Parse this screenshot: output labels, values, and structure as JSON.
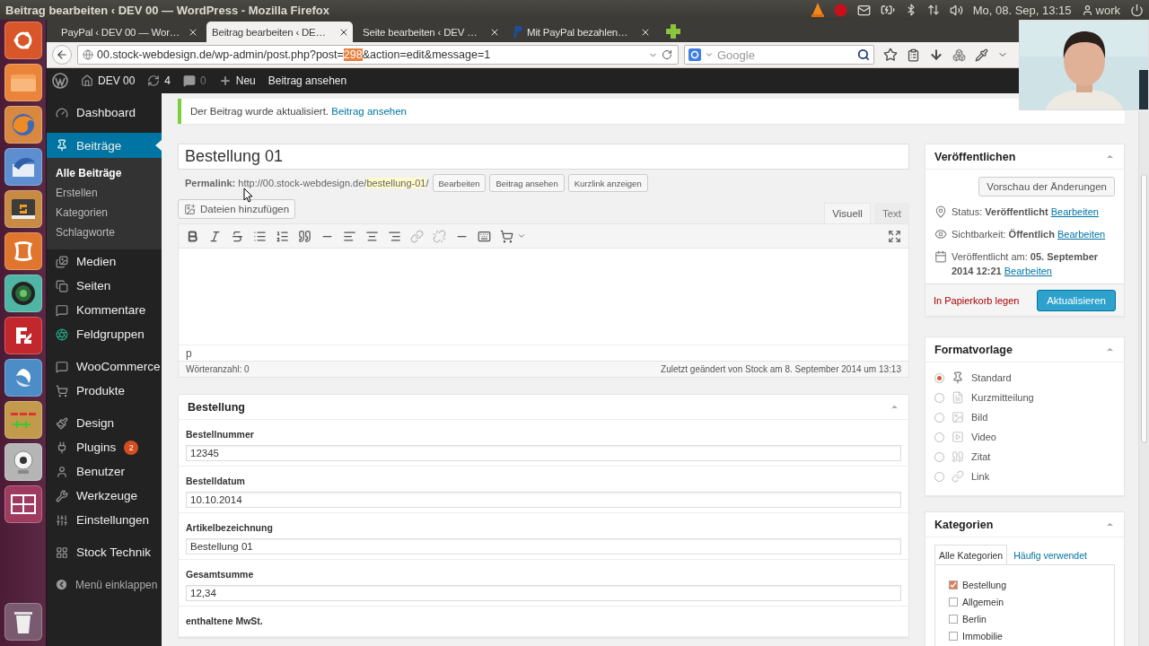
{
  "top_panel": {
    "title": "Beitrag bearbeiten ‹ DEV 00 — WordPress - Mozilla Firefox",
    "clock": "Mo, 08. Sep, 13:15",
    "user": "work"
  },
  "browser": {
    "tabs": [
      {
        "label": "PayPal ‹ DEV 00 — Wor…",
        "selected": false
      },
      {
        "label": "Beitrag bearbeiten ‹ DE…",
        "selected": true
      },
      {
        "label": "Seite bearbeiten ‹ DEV …",
        "selected": false
      },
      {
        "label": "Mit PayPal bezahlen…",
        "selected": false
      }
    ],
    "address": {
      "before": "00.stock-webdesign.de/wp-admin/post.php?post=",
      "highlight": "298",
      "after": "&action=edit&message=1"
    },
    "search": {
      "placeholder": "Google"
    }
  },
  "admin_bar": {
    "site": "DEV 00",
    "updates": "4",
    "comments": "0",
    "new": "Neu",
    "view": "Beitrag ansehen"
  },
  "menu": {
    "groups": [
      [
        {
          "label": "Dashboard",
          "selected": false
        }
      ],
      [
        {
          "label": "Beiträge",
          "selected": true,
          "children": [
            {
              "label": "Alle Beiträge",
              "selected": true
            },
            {
              "label": "Erstellen",
              "selected": false
            },
            {
              "label": "Kategorien",
              "selected": false
            },
            {
              "label": "Schlagworte",
              "selected": false
            }
          ]
        },
        {
          "label": "Medien",
          "selected": false
        },
        {
          "label": "Seiten",
          "selected": false
        },
        {
          "label": "Kommentare",
          "selected": false
        },
        {
          "label": "Feldgruppen",
          "selected": false
        }
      ],
      [
        {
          "label": "WooCommerce",
          "selected": false
        },
        {
          "label": "Produkte",
          "selected": false
        }
      ],
      [
        {
          "label": "Design",
          "selected": false
        },
        {
          "label": "Plugins",
          "selected": false,
          "badge": "2"
        },
        {
          "label": "Benutzer",
          "selected": false
        },
        {
          "label": "Werkzeuge",
          "selected": false
        },
        {
          "label": "Einstellungen",
          "selected": false
        }
      ],
      [
        {
          "label": "Stock Technik",
          "selected": false
        }
      ]
    ],
    "collapse": "Menü einklappen"
  },
  "notice": {
    "text": "Der Beitrag wurde aktualisiert.",
    "link": "Beitrag ansehen"
  },
  "post": {
    "title": "Bestellung 01",
    "permalink": {
      "label": "Permalink:",
      "base": "http://00.stock-webdesign.de/",
      "slug": "bestellung-01",
      "trail": "/"
    },
    "permalink_buttons": [
      "Bearbeiten",
      "Beitrag ansehen",
      "Kurzlink anzeigen"
    ],
    "media_button": "Dateien hinzufügen",
    "editor_tabs": [
      {
        "label": "Visuell",
        "selected": true
      },
      {
        "label": "Text",
        "selected": false
      }
    ],
    "path": "p",
    "word_count": "Wörteranzahl: 0",
    "last_edited": "Zuletzt geändert von Stock am 8. September 2014 um 13:13"
  },
  "order_box": {
    "title": "Bestellung",
    "fields": [
      {
        "label": "Bestellnummer",
        "value": "12345"
      },
      {
        "label": "Bestelldatum",
        "value": "10.10.2014"
      },
      {
        "label": "Artikelbezeichnung",
        "value": "Bestellung 01"
      },
      {
        "label": "Gesamtsumme",
        "value": "12,34"
      },
      {
        "label": "enthaltene MwSt."
      }
    ]
  },
  "publish": {
    "title": "Veröffentlichen",
    "preview": "Vorschau der Änderungen",
    "rows": [
      {
        "label": "Status:",
        "value": "Veröffentlicht",
        "link": "Bearbeiten"
      },
      {
        "label": "Sichtbarkeit:",
        "value": "Öffentlich",
        "link": "Bearbeiten"
      },
      {
        "label": "Veröffentlicht am:",
        "value": "05. September 2014 12:21",
        "link": "Bearbeiten"
      }
    ],
    "trash": "In Papierkorb legen",
    "update": "Aktualisieren"
  },
  "formats": {
    "title": "Formatvorlage",
    "options": [
      {
        "label": "Standard",
        "selected": true
      },
      {
        "label": "Kurzmitteilung",
        "selected": false
      },
      {
        "label": "Bild",
        "selected": false
      },
      {
        "label": "Video",
        "selected": false
      },
      {
        "label": "Zitat",
        "selected": false
      },
      {
        "label": "Link",
        "selected": false
      }
    ]
  },
  "categories": {
    "title": "Kategorien",
    "tabs": [
      {
        "label": "Alle Kategorien",
        "selected": true
      },
      {
        "label": "Häufig verwendet",
        "selected": false
      }
    ],
    "items": [
      {
        "label": "Bestellung",
        "checked": true
      },
      {
        "label": "Allgemein",
        "checked": false
      },
      {
        "label": "Berlin",
        "checked": false
      },
      {
        "label": "Immobilie",
        "checked": false
      }
    ]
  }
}
